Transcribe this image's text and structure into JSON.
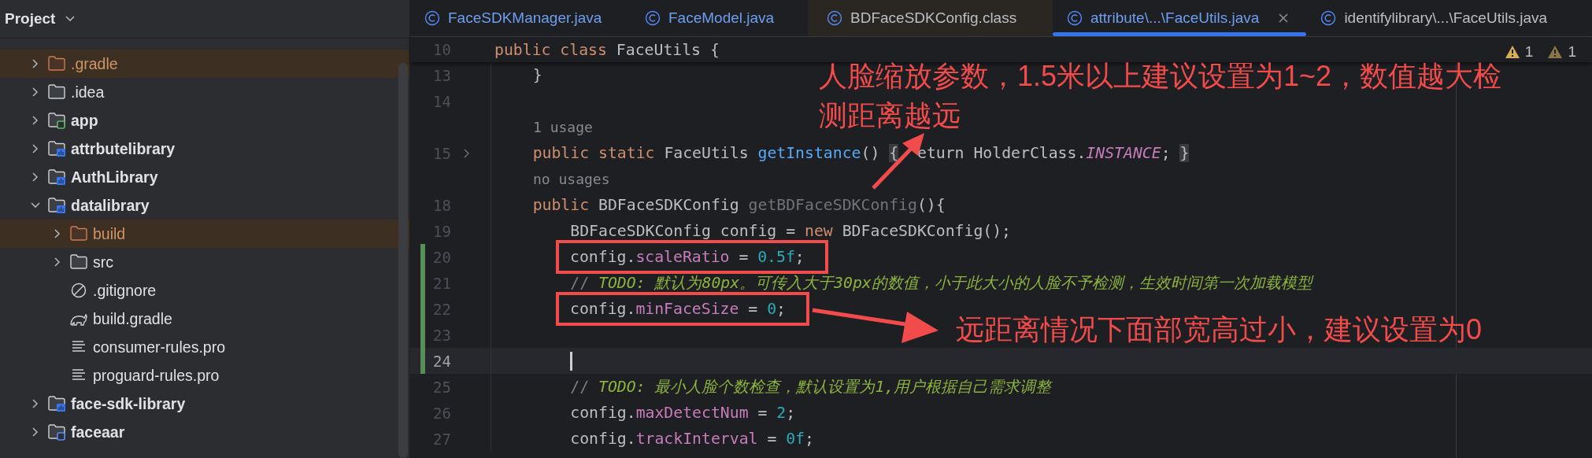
{
  "sidebar": {
    "title": "Project",
    "items": [
      {
        "label": ".gradle",
        "kind": "folder",
        "excluded": true,
        "expanded": false
      },
      {
        "label": ".idea",
        "kind": "folder",
        "excluded": false,
        "expanded": false
      },
      {
        "label": "app",
        "kind": "app-module",
        "excluded": false,
        "expanded": false
      },
      {
        "label": "attrbutelibrary",
        "kind": "library-module",
        "excluded": false,
        "expanded": false
      },
      {
        "label": "AuthLibrary",
        "kind": "library-module",
        "excluded": false,
        "expanded": false
      },
      {
        "label": "datalibrary",
        "kind": "library-module",
        "excluded": false,
        "expanded": true,
        "children": [
          {
            "label": "build",
            "kind": "folder",
            "excluded": true,
            "expanded": false
          },
          {
            "label": "src",
            "kind": "folder",
            "excluded": false,
            "expanded": false
          },
          {
            "label": ".gitignore",
            "kind": "ignore-file",
            "excluded": false
          },
          {
            "label": "build.gradle",
            "kind": "gradle-file",
            "excluded": false
          },
          {
            "label": "consumer-rules.pro",
            "kind": "text-file",
            "excluded": false
          },
          {
            "label": "proguard-rules.pro",
            "kind": "text-file",
            "excluded": false
          }
        ]
      },
      {
        "label": "face-sdk-library",
        "kind": "library-module",
        "excluded": false,
        "expanded": false
      },
      {
        "label": "faceaar",
        "kind": "module",
        "excluded": false,
        "expanded": false
      }
    ]
  },
  "tabs": [
    {
      "label": "FaceSDKManager.java",
      "selected": false,
      "modified": true,
      "read_only": false
    },
    {
      "label": "FaceModel.java",
      "selected": false,
      "modified": true,
      "read_only": false
    },
    {
      "label": "BDFaceSDKConfig.class",
      "selected": false,
      "modified": false,
      "read_only": true
    },
    {
      "label": "attribute\\...\\FaceUtils.java",
      "selected": true,
      "modified": true,
      "read_only": false
    },
    {
      "label": "identifylibrary\\...\\FaceUtils.java",
      "selected": false,
      "modified": false,
      "read_only": false
    }
  ],
  "inspections": [
    {
      "kind": "warning",
      "count": "1"
    },
    {
      "kind": "weak-warning",
      "count": "1"
    }
  ],
  "sticky_line": {
    "number": "10",
    "tokens": [
      {
        "text": "public class",
        "kind": "keyword"
      },
      {
        "text": " FaceUtils {",
        "kind": "plain"
      }
    ]
  },
  "lines": [
    {
      "number": "13",
      "changed": false,
      "current": false,
      "fold_marker": false,
      "boxed": false,
      "tokens": [
        {
          "text": "    }",
          "kind": "plain"
        }
      ]
    },
    {
      "number": "14",
      "changed": false,
      "current": false,
      "fold_marker": false,
      "boxed": false
    },
    {
      "hint": "1 usage"
    },
    {
      "number": "15",
      "changed": false,
      "current": false,
      "fold_marker": true,
      "boxed": false,
      "tokens": [
        {
          "text": "    public static",
          "kind": "keyword"
        },
        {
          "text": " FaceUtils ",
          "kind": "plain"
        },
        {
          "text": "getInstance",
          "kind": "method"
        },
        {
          "text": "() ",
          "kind": "plain"
        },
        {
          "text": "{",
          "kind": "folded"
        },
        {
          "text": "  eturn HolderClass.",
          "kind": "plain"
        },
        {
          "text": "INSTANCE",
          "kind": "static-field"
        },
        {
          "text": "; ",
          "kind": "plain"
        },
        {
          "text": "}",
          "kind": "folded"
        }
      ]
    },
    {
      "hint": "no usages"
    },
    {
      "number": "18",
      "changed": false,
      "current": false,
      "fold_marker": false,
      "boxed": false,
      "tokens": [
        {
          "text": "    public",
          "kind": "keyword"
        },
        {
          "text": " BDFaceSDKConfig ",
          "kind": "plain"
        },
        {
          "text": "getBDFaceSDKConfig",
          "kind": "unused"
        },
        {
          "text": "(){",
          "kind": "plain"
        }
      ]
    },
    {
      "number": "19",
      "changed": false,
      "current": false,
      "fold_marker": false,
      "boxed": false,
      "tokens": [
        {
          "text": "        BDFaceSDKConfig config = ",
          "kind": "plain"
        },
        {
          "text": "new",
          "kind": "keyword"
        },
        {
          "text": " BDFaceSDKConfig();",
          "kind": "plain"
        }
      ]
    },
    {
      "number": "20",
      "changed": true,
      "current": false,
      "fold_marker": false,
      "boxed": true,
      "tokens": [
        {
          "text": "config.",
          "kind": "plain"
        },
        {
          "text": "scaleRatio",
          "kind": "field"
        },
        {
          "text": " = ",
          "kind": "plain"
        },
        {
          "text": "0.5f",
          "kind": "number"
        },
        {
          "text": ";",
          "kind": "plain"
        }
      ]
    },
    {
      "number": "21",
      "changed": true,
      "current": false,
      "fold_marker": false,
      "boxed": false,
      "tokens": [
        {
          "text": "        // ",
          "kind": "comment"
        },
        {
          "text": "TODO: 默认为80px。可传入大于30px的数值，小于此大小的人脸不予检测，生效时间第一次加载模型",
          "kind": "todo"
        }
      ]
    },
    {
      "number": "22",
      "changed": true,
      "current": false,
      "fold_marker": false,
      "boxed": true,
      "tokens": [
        {
          "text": "config.",
          "kind": "plain"
        },
        {
          "text": "minFaceSize",
          "kind": "field"
        },
        {
          "text": " = ",
          "kind": "plain"
        },
        {
          "text": "0",
          "kind": "number"
        },
        {
          "text": ";",
          "kind": "plain"
        }
      ]
    },
    {
      "number": "23",
      "changed": true,
      "current": false,
      "fold_marker": false,
      "boxed": false
    },
    {
      "number": "24",
      "changed": true,
      "current": true,
      "fold_marker": false,
      "boxed": false
    },
    {
      "number": "25",
      "changed": false,
      "current": false,
      "fold_marker": false,
      "boxed": false,
      "tokens": [
        {
          "text": "        // ",
          "kind": "comment"
        },
        {
          "text": "TODO: 最小人脸个数检查，默认设置为1,用户根据自己需求调整",
          "kind": "todo"
        }
      ]
    },
    {
      "number": "26",
      "changed": false,
      "current": false,
      "fold_marker": false,
      "boxed": false,
      "tokens": [
        {
          "text": "        config.",
          "kind": "plain"
        },
        {
          "text": "maxDetectNum",
          "kind": "field"
        },
        {
          "text": " = ",
          "kind": "plain"
        },
        {
          "text": "2",
          "kind": "number"
        },
        {
          "text": ";",
          "kind": "plain"
        }
      ]
    },
    {
      "number": "27",
      "changed": false,
      "current": false,
      "fold_marker": false,
      "boxed": false,
      "tokens": [
        {
          "text": "        config.",
          "kind": "plain"
        },
        {
          "text": "trackInterval",
          "kind": "field"
        },
        {
          "text": " = ",
          "kind": "plain"
        },
        {
          "text": "0f",
          "kind": "number"
        },
        {
          "text": ";",
          "kind": "plain"
        }
      ]
    }
  ],
  "annotations": [
    {
      "text": "人脸缩放参数，1.5米以上建议设置为1~2，数值越大检测距离越远"
    },
    {
      "text": "远距离情况下面部宽高过小，建议设置为0"
    }
  ]
}
